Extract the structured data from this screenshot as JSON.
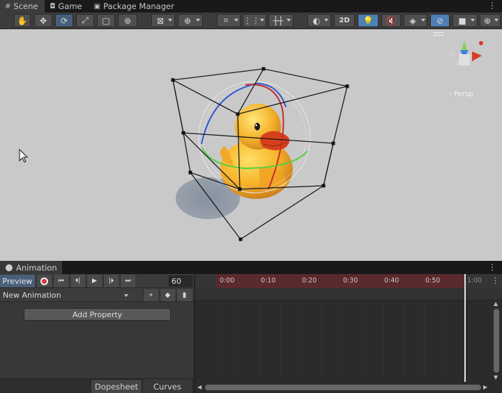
{
  "tabs": [
    {
      "label": "Scene",
      "icon": "grid-icon"
    },
    {
      "label": "Game",
      "icon": "gamepad-icon"
    },
    {
      "label": "Package Manager",
      "icon": "package-icon"
    }
  ],
  "toolbar": {
    "label_2d": "2D",
    "tools": [
      "hand-tool",
      "move-tool",
      "rotate-tool",
      "scale-tool",
      "rect-tool",
      "transform-tool"
    ],
    "active_tool": "rotate-tool"
  },
  "scene": {
    "camera_mode": "Persp",
    "background_color": "#c9c9c9",
    "selection_color": "#1a1a1a"
  },
  "animation": {
    "tab_label": "Animation",
    "preview_label": "Preview",
    "frame_value": "60",
    "clip_name": "New Animation",
    "add_property_label": "Add Property",
    "dopesheet_label": "Dopesheet",
    "curves_label": "Curves",
    "ruler_ticks": [
      "0:00",
      "0:10",
      "0:20",
      "0:30",
      "0:40",
      "0:50",
      "1:00"
    ],
    "record_color": "#d23a3a"
  }
}
